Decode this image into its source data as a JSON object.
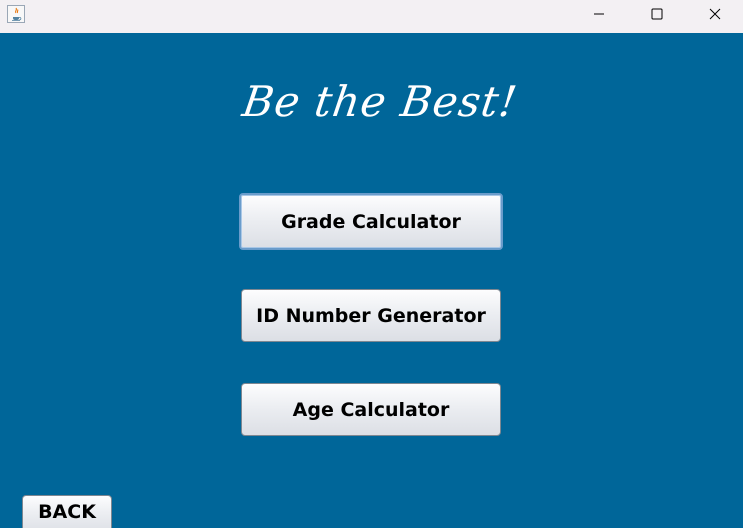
{
  "window": {
    "app_icon": "java-icon",
    "controls": {
      "minimize_icon": "minimize-icon",
      "maximize_icon": "maximize-icon",
      "close_icon": "close-icon"
    }
  },
  "main": {
    "headline": "Be the Best!",
    "buttons": [
      {
        "label": "Grade Calculator"
      },
      {
        "label": "ID Number Generator"
      },
      {
        "label": "Age Calculator"
      }
    ],
    "back_label": "BACK"
  },
  "colors": {
    "background": "#006699",
    "titlebar": "#f3f0f3",
    "focus_border": "#6a9ccb",
    "button_text": "#000000",
    "headline": "#ffffff"
  }
}
